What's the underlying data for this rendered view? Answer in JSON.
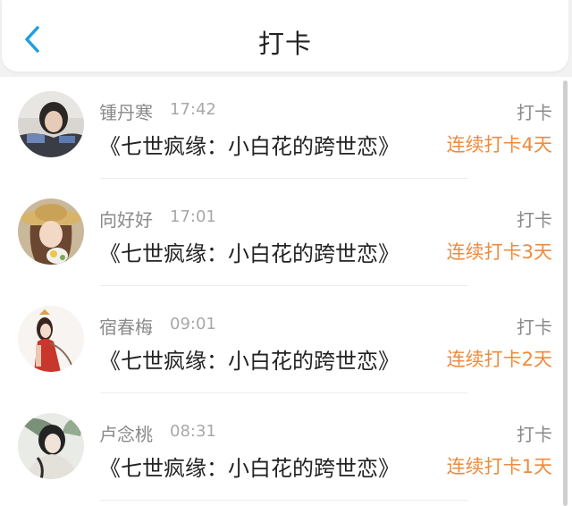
{
  "header": {
    "title": "打卡",
    "back_icon": "chevron-left-icon"
  },
  "colors": {
    "accent": "#1e9ee6",
    "streak": "#f08a3c",
    "muted": "#8a8a8a"
  },
  "entries": [
    {
      "name": "锺丹寒",
      "time": "17:42",
      "book": "《七世疯缘：小白花的跨世恋》",
      "action": "打卡",
      "streak": "连续打卡4天"
    },
    {
      "name": "向好好",
      "time": "17:01",
      "book": "《七世疯缘：小白花的跨世恋》",
      "action": "打卡",
      "streak": "连续打卡3天"
    },
    {
      "name": "宿春梅",
      "time": "09:01",
      "book": "《七世疯缘：小白花的跨世恋》",
      "action": "打卡",
      "streak": "连续打卡2天"
    },
    {
      "name": "卢念桃",
      "time": "08:31",
      "book": "《七世疯缘：小白花的跨世恋》",
      "action": "打卡",
      "streak": "连续打卡1天"
    }
  ]
}
